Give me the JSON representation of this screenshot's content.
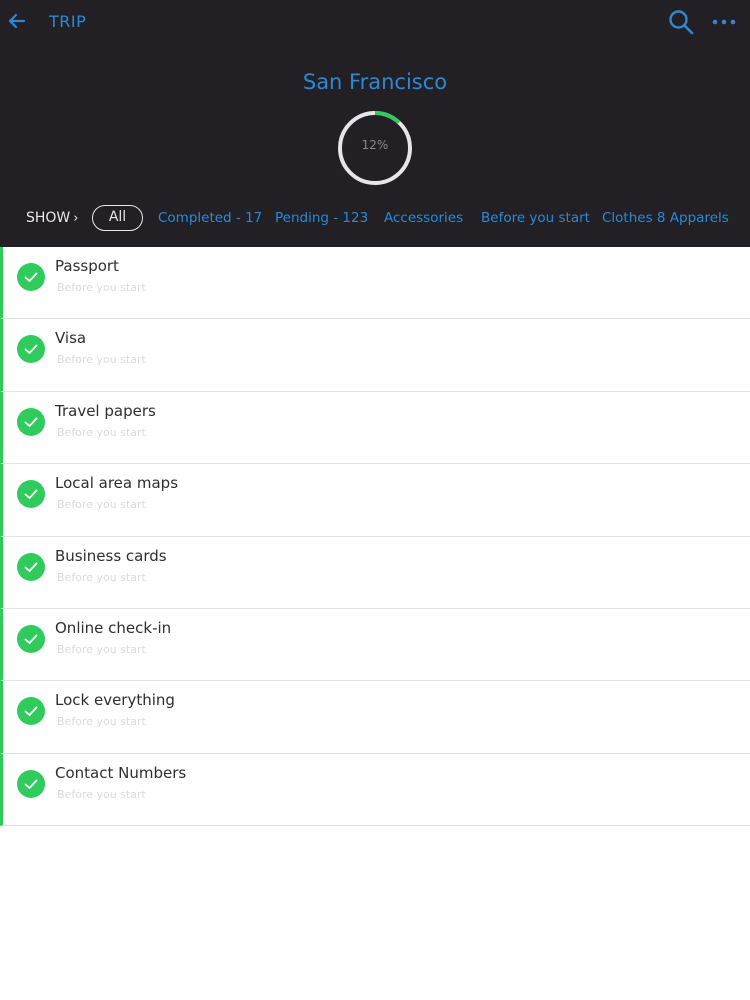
{
  "topbar": {
    "title": "TRIP",
    "back_icon": "arrow-left-icon",
    "search_icon": "search-icon",
    "more_icon": "more-horizontal-icon"
  },
  "trip": {
    "name": "San Francisco",
    "progress_label": "12%",
    "progress_fraction": 0.12
  },
  "filters": {
    "show_label": "SHOW",
    "all_label": "All",
    "tabs": [
      "Completed - 17",
      "Pending - 123",
      "Accessories",
      "Before you start",
      "Clothes 8 Apparels"
    ]
  },
  "items": [
    {
      "title": "Passport",
      "subtitle": "Before you start"
    },
    {
      "title": "Visa",
      "subtitle": "Before you start"
    },
    {
      "title": "Travel papers",
      "subtitle": "Before you start"
    },
    {
      "title": "Local area maps",
      "subtitle": "Before you start"
    },
    {
      "title": "Business cards",
      "subtitle": "Before you start"
    },
    {
      "title": "Online check-in",
      "subtitle": "Before you start"
    },
    {
      "title": "Lock everything",
      "subtitle": "Before you start"
    },
    {
      "title": "Contact Numbers",
      "subtitle": "Before you start"
    }
  ],
  "colors": {
    "header_bg": "#221f25",
    "accent_blue": "#2a8ad6",
    "check_green": "#2fcb5c",
    "ring_grey": "#e6e6e6"
  }
}
